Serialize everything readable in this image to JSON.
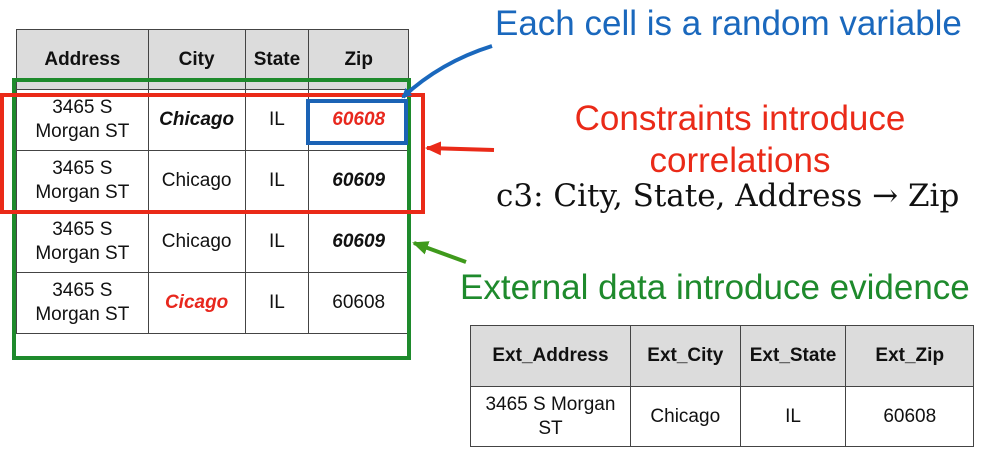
{
  "main_table": {
    "headers": [
      "Address",
      "City",
      "State",
      "Zip"
    ],
    "rows": [
      {
        "address": "3465 S Morgan ST",
        "city": "Chicago",
        "state": "IL",
        "zip": "60608"
      },
      {
        "address": "3465 S Morgan ST",
        "city": "Chicago",
        "state": "IL",
        "zip": "60609"
      },
      {
        "address": "3465 S Morgan ST",
        "city": "Chicago",
        "state": "IL",
        "zip": "60609"
      },
      {
        "address": "3465 S Morgan ST",
        "city": "Cicago",
        "state": "IL",
        "zip": "60608"
      }
    ]
  },
  "ext_table": {
    "headers": [
      "Ext_Address",
      "Ext_City",
      "Ext_State",
      "Ext_Zip"
    ],
    "rows": [
      {
        "address": "3465 S Morgan ST",
        "city": "Chicago",
        "state": "IL",
        "zip": "60608"
      }
    ]
  },
  "annotations": {
    "cell_label": "Each cell is a random variable",
    "constraint_label": "Constraints introduce correlations",
    "rule": "c3: City, State, Address → Zip",
    "evidence_label": "External data introduce evidence"
  },
  "colors": {
    "blue": "#1a68bd",
    "red": "#ea2a18",
    "green": "#1e8a2c",
    "header_bg": "#dcdcdc"
  }
}
